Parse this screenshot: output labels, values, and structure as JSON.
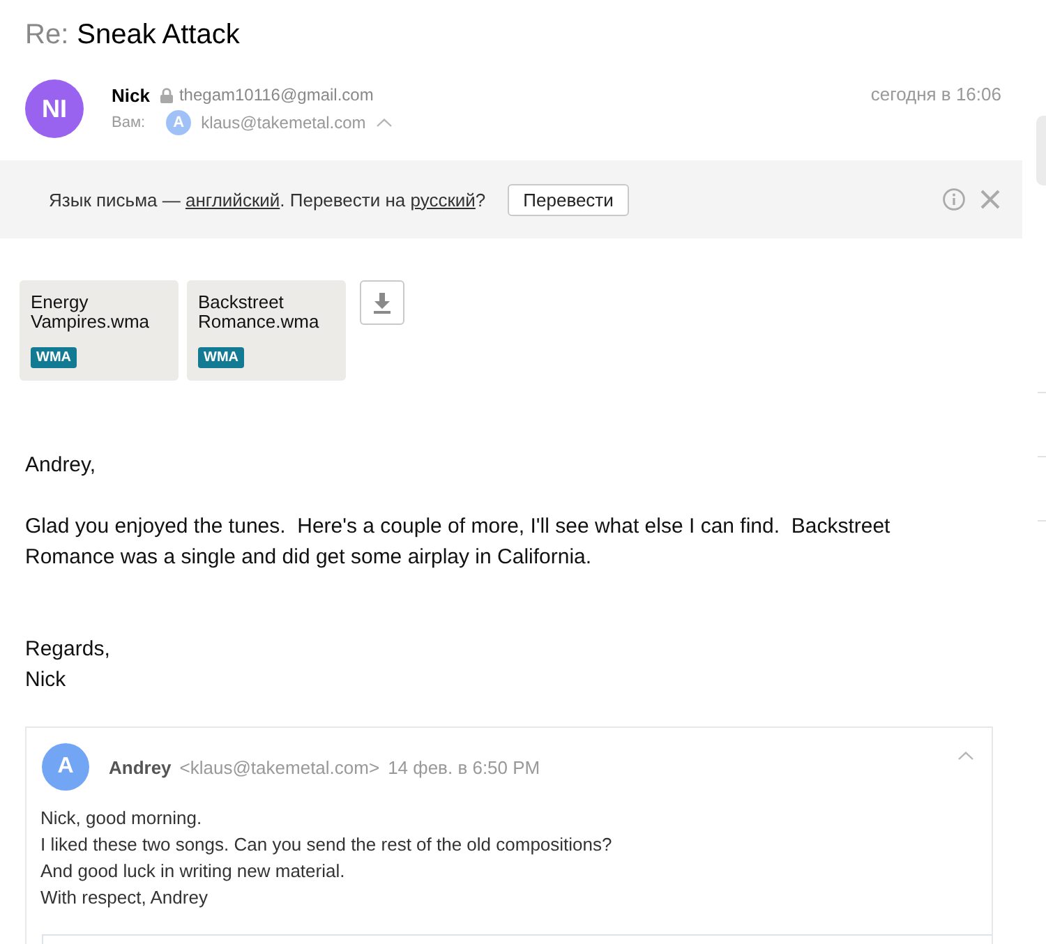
{
  "subject": {
    "prefix": "Re:",
    "title": "Sneak Attack"
  },
  "sender": {
    "initials": "NI",
    "name": "Nick",
    "email": "thegam10116@gmail.com",
    "to_label": "Вам:",
    "recipient_initials": "A",
    "recipient_email": "klaus@takemetal.com",
    "date": "сегодня в 16:06"
  },
  "translate_bar": {
    "parts": [
      {
        "kind": "text",
        "text": "Язык письма — "
      },
      {
        "kind": "link",
        "text": "английский"
      },
      {
        "kind": "text",
        "text": ". Перевести на "
      },
      {
        "kind": "link",
        "text": "русский"
      },
      {
        "kind": "text",
        "text": "?"
      }
    ],
    "button": "Перевести"
  },
  "attachments": [
    {
      "name": "Energy Vampires.wma",
      "badge": "WMA"
    },
    {
      "name": "Backstreet Romance.wma",
      "badge": "WMA"
    }
  ],
  "body": [
    {
      "lines": [
        "Andrey,"
      ]
    },
    {
      "lines": [
        "Glad you enjoyed the tunes.  Here's a couple of more, I'll see what else I can find.  Backstreet Romance was a single and did get some airplay in California."
      ]
    },
    {
      "lines": [
        "Regards,",
        "Nick"
      ]
    }
  ],
  "quoted_message": {
    "initials": "A",
    "name": "Andrey",
    "email": "<klaus@takemetal.com>",
    "date": "14 фев. в 6:50 PM",
    "lines": [
      "Nick, good morning.",
      "I liked these two songs. Can you send the rest of the old compositions?",
      "And good luck in writing new material.",
      "With respect, Andrey"
    ]
  }
}
